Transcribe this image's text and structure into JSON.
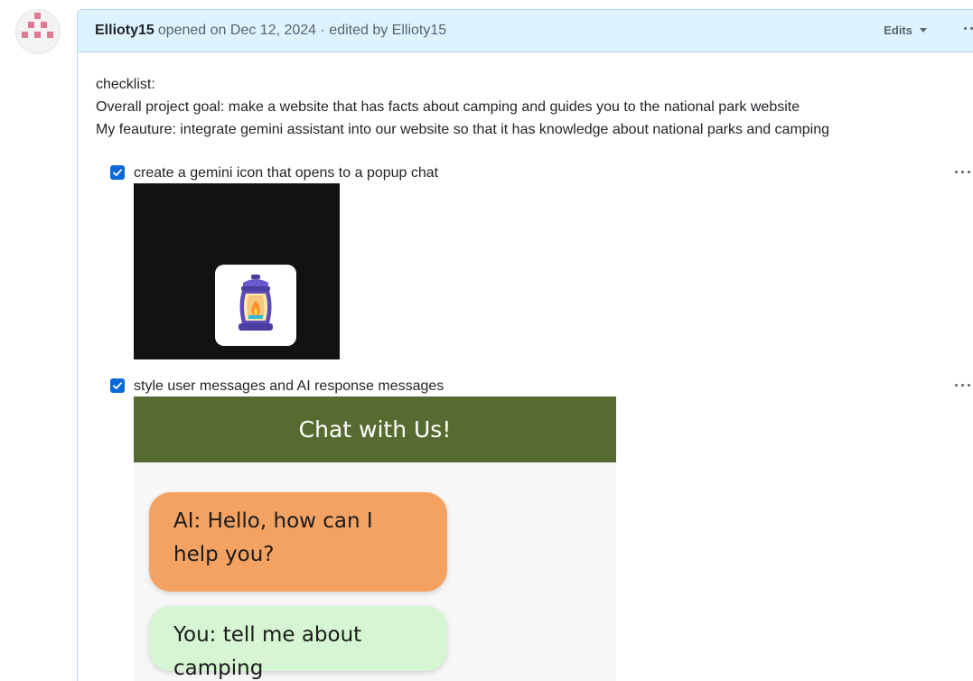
{
  "header": {
    "author": "Ellioty15",
    "meta": "opened on Dec 12, 2024 · edited by Ellioty15",
    "edits_label": "Edits"
  },
  "body": {
    "lines": [
      "checklist:",
      "Overall project goal: make a website that has facts about camping and guides you to the national park website",
      "My feauture: integrate gemini assistant into our website so that it has knowledge about national parks and camping"
    ]
  },
  "tasks": [
    {
      "label": "create a gemini icon that opens to a popup chat",
      "checked": true
    },
    {
      "label": "style user messages and AI response messages",
      "checked": true
    }
  ],
  "chat_preview": {
    "title": "Chat with Us!",
    "ai_message": "AI: Hello, how can I help you?",
    "user_message": "You: tell me about camping"
  },
  "colors": {
    "header_bg": "#ddf4ff",
    "checkbox": "#0969da",
    "chat_header": "#576b30",
    "ai_bubble": "#f4a261",
    "user_bubble": "#d6f5d2"
  }
}
